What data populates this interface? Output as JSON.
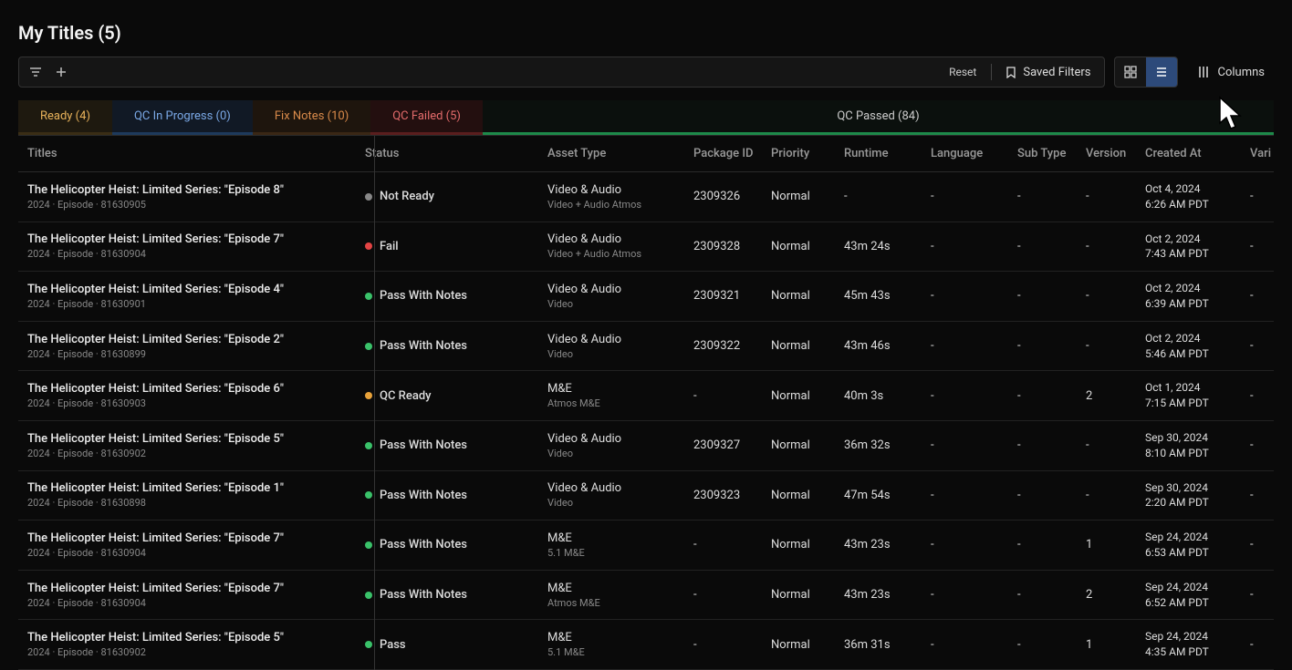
{
  "page": {
    "title": "My Titles (5)"
  },
  "toolbar": {
    "reset": "Reset",
    "saved_filters": "Saved Filters",
    "columns": "Columns"
  },
  "tabs": [
    {
      "key": "ready",
      "label": "Ready (4)"
    },
    {
      "key": "progress",
      "label": "QC In Progress (0)"
    },
    {
      "key": "fix",
      "label": "Fix Notes (10)"
    },
    {
      "key": "failed",
      "label": "QC Failed (5)"
    },
    {
      "key": "passed",
      "label": "QC Passed (84)"
    }
  ],
  "columns": {
    "titles": "Titles",
    "status": "Status",
    "asset_type": "Asset Type",
    "package_id": "Package ID",
    "priority": "Priority",
    "runtime": "Runtime",
    "language": "Language",
    "sub_type": "Sub Type",
    "version": "Version",
    "created_at": "Created At",
    "variant": "Vari"
  },
  "rows": [
    {
      "title": "The Helicopter Heist: Limited Series: \"Episode 8\"",
      "meta": "2024 · Episode · 81630905",
      "status": "Not Ready",
      "status_dot": "grey",
      "asset_main": "Video & Audio",
      "asset_sub": "Video + Audio Atmos",
      "package_id": "2309326",
      "priority": "Normal",
      "runtime": "-",
      "language": "-",
      "sub_type": "-",
      "version": "-",
      "created_d": "Oct 4, 2024",
      "created_t": "6:26 AM PDT",
      "variant": "-"
    },
    {
      "title": "The Helicopter Heist: Limited Series: \"Episode 7\"",
      "meta": "2024 · Episode · 81630904",
      "status": "Fail",
      "status_dot": "red",
      "asset_main": "Video & Audio",
      "asset_sub": "Video + Audio Atmos",
      "package_id": "2309328",
      "priority": "Normal",
      "runtime": "43m 24s",
      "language": "-",
      "sub_type": "-",
      "version": "-",
      "created_d": "Oct 2, 2024",
      "created_t": "7:43 AM PDT",
      "variant": "-"
    },
    {
      "title": "The Helicopter Heist: Limited Series: \"Episode 4\"",
      "meta": "2024 · Episode · 81630901",
      "status": "Pass With Notes",
      "status_dot": "green",
      "asset_main": "Video & Audio",
      "asset_sub": "Video",
      "package_id": "2309321",
      "priority": "Normal",
      "runtime": "45m 43s",
      "language": "-",
      "sub_type": "-",
      "version": "-",
      "created_d": "Oct 2, 2024",
      "created_t": "6:39 AM PDT",
      "variant": "-"
    },
    {
      "title": "The Helicopter Heist: Limited Series: \"Episode 2\"",
      "meta": "2024 · Episode · 81630899",
      "status": "Pass With Notes",
      "status_dot": "green",
      "asset_main": "Video & Audio",
      "asset_sub": "Video",
      "package_id": "2309322",
      "priority": "Normal",
      "runtime": "43m 46s",
      "language": "-",
      "sub_type": "-",
      "version": "-",
      "created_d": "Oct 2, 2024",
      "created_t": "5:46 AM PDT",
      "variant": "-"
    },
    {
      "title": "The Helicopter Heist: Limited Series: \"Episode 6\"",
      "meta": "2024 · Episode · 81630903",
      "status": "QC Ready",
      "status_dot": "orange",
      "asset_main": "M&E",
      "asset_sub": "Atmos M&E",
      "package_id": "-",
      "priority": "Normal",
      "runtime": "40m 3s",
      "language": "-",
      "sub_type": "-",
      "version": "2",
      "created_d": "Oct 1, 2024",
      "created_t": "7:15 AM PDT",
      "variant": "-"
    },
    {
      "title": "The Helicopter Heist: Limited Series: \"Episode 5\"",
      "meta": "2024 · Episode · 81630902",
      "status": "Pass With Notes",
      "status_dot": "green",
      "asset_main": "Video & Audio",
      "asset_sub": "Video",
      "package_id": "2309327",
      "priority": "Normal",
      "runtime": "36m 32s",
      "language": "-",
      "sub_type": "-",
      "version": "-",
      "created_d": "Sep 30, 2024",
      "created_t": "8:10 AM PDT",
      "variant": "-"
    },
    {
      "title": "The Helicopter Heist: Limited Series: \"Episode 1\"",
      "meta": "2024 · Episode · 81630898",
      "status": "Pass With Notes",
      "status_dot": "green",
      "asset_main": "Video & Audio",
      "asset_sub": "Video",
      "package_id": "2309323",
      "priority": "Normal",
      "runtime": "47m 54s",
      "language": "-",
      "sub_type": "-",
      "version": "-",
      "created_d": "Sep 30, 2024",
      "created_t": "2:20 AM PDT",
      "variant": "-"
    },
    {
      "title": "The Helicopter Heist: Limited Series: \"Episode 7\"",
      "meta": "2024 · Episode · 81630904",
      "status": "Pass With Notes",
      "status_dot": "green",
      "asset_main": "M&E",
      "asset_sub": "5.1 M&E",
      "package_id": "-",
      "priority": "Normal",
      "runtime": "43m 23s",
      "language": "-",
      "sub_type": "-",
      "version": "1",
      "created_d": "Sep 24, 2024",
      "created_t": "6:53 AM PDT",
      "variant": "-"
    },
    {
      "title": "The Helicopter Heist: Limited Series: \"Episode 7\"",
      "meta": "2024 · Episode · 81630904",
      "status": "Pass With Notes",
      "status_dot": "green",
      "asset_main": "M&E",
      "asset_sub": "Atmos M&E",
      "package_id": "-",
      "priority": "Normal",
      "runtime": "43m 23s",
      "language": "-",
      "sub_type": "-",
      "version": "2",
      "created_d": "Sep 24, 2024",
      "created_t": "6:52 AM PDT",
      "variant": "-"
    },
    {
      "title": "The Helicopter Heist: Limited Series: \"Episode 5\"",
      "meta": "2024 · Episode · 81630902",
      "status": "Pass",
      "status_dot": "green",
      "asset_main": "M&E",
      "asset_sub": "5.1 M&E",
      "package_id": "-",
      "priority": "Normal",
      "runtime": "36m 31s",
      "language": "-",
      "sub_type": "-",
      "version": "1",
      "created_d": "Sep 24, 2024",
      "created_t": "4:35 AM PDT",
      "variant": "-"
    }
  ]
}
